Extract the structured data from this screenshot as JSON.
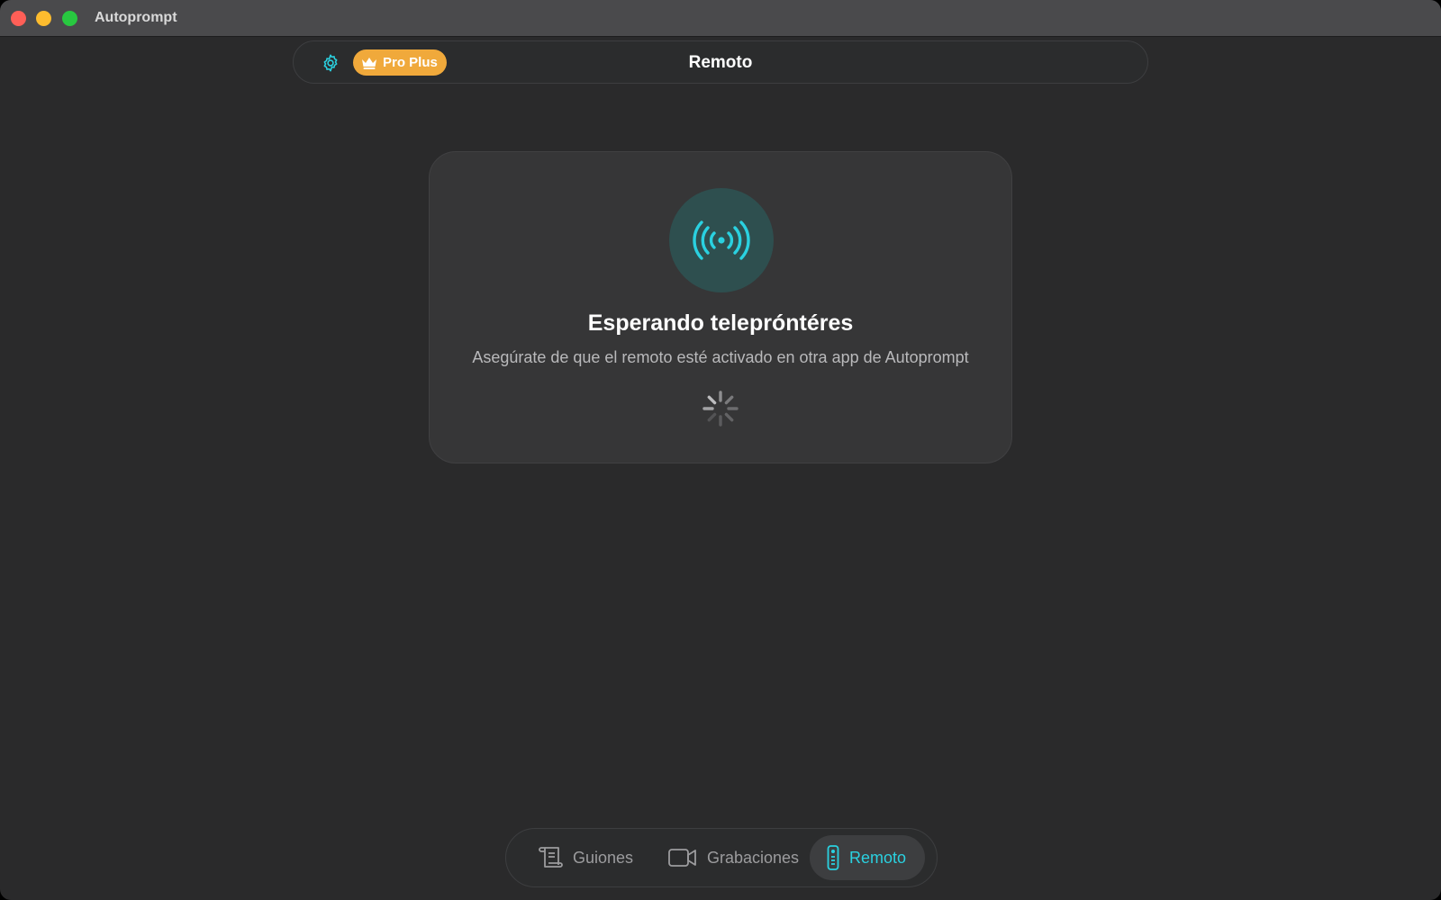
{
  "window": {
    "title": "Autoprompt"
  },
  "header": {
    "settings_icon": "gear-icon",
    "badge_icon": "crown-icon",
    "badge_label": "Pro Plus",
    "title": "Remoto"
  },
  "card": {
    "icon": "broadcast-signal-icon",
    "title": "Esperando telepróntéres",
    "subtitle": "Asegúrate de que el remoto esté activado en otra app de Autoprompt",
    "spinner_icon": "loading-spinner-icon"
  },
  "tabs": [
    {
      "label": "Guiones",
      "icon": "script-scroll-icon",
      "selected": false
    },
    {
      "label": "Grabaciones",
      "icon": "video-camera-icon",
      "selected": false
    },
    {
      "label": "Remoto",
      "icon": "remote-control-icon",
      "selected": true
    }
  ],
  "colors": {
    "accent": "#2ad1e0",
    "badge": "#f0a93b",
    "background": "#2a2a2b"
  }
}
